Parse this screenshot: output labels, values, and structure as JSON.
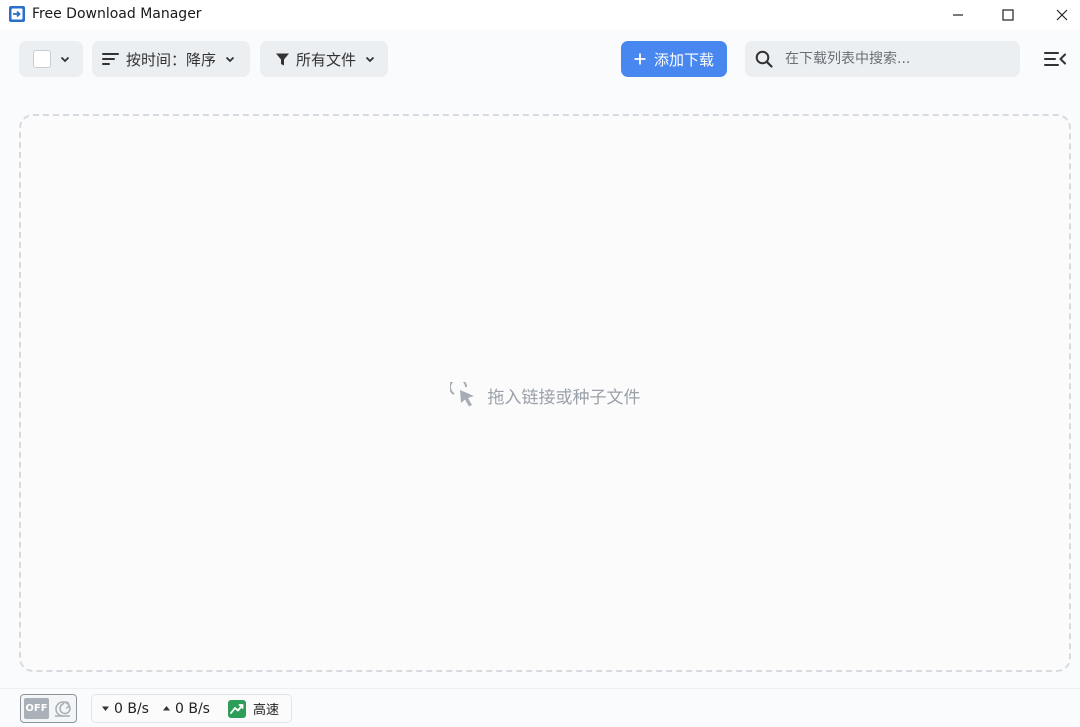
{
  "window": {
    "title": "Free Download Manager"
  },
  "toolbar": {
    "sort_label": "按时间：降序",
    "filter_label": "所有文件",
    "add_label": "添加下载",
    "search_placeholder": "在下载列表中搜索..."
  },
  "main": {
    "drop_hint": "拖入链接或种子文件"
  },
  "status": {
    "snail_toggle_label": "OFF",
    "download_speed": "0 B/s",
    "upload_speed": "0 B/s",
    "mode_label": "高速"
  },
  "colors": {
    "accent": "#4787ef",
    "high_speed": "#2f9d5a"
  },
  "icons": [
    "app-logo-icon",
    "minimize-icon",
    "maximize-icon",
    "close-icon",
    "chevron-down-icon",
    "sort-icon",
    "filter-icon",
    "plus-icon",
    "search-icon",
    "menu-collapse-icon",
    "cursor-click-icon",
    "snail-icon",
    "download-arrow-icon",
    "upload-arrow-icon",
    "speed-chart-icon"
  ]
}
